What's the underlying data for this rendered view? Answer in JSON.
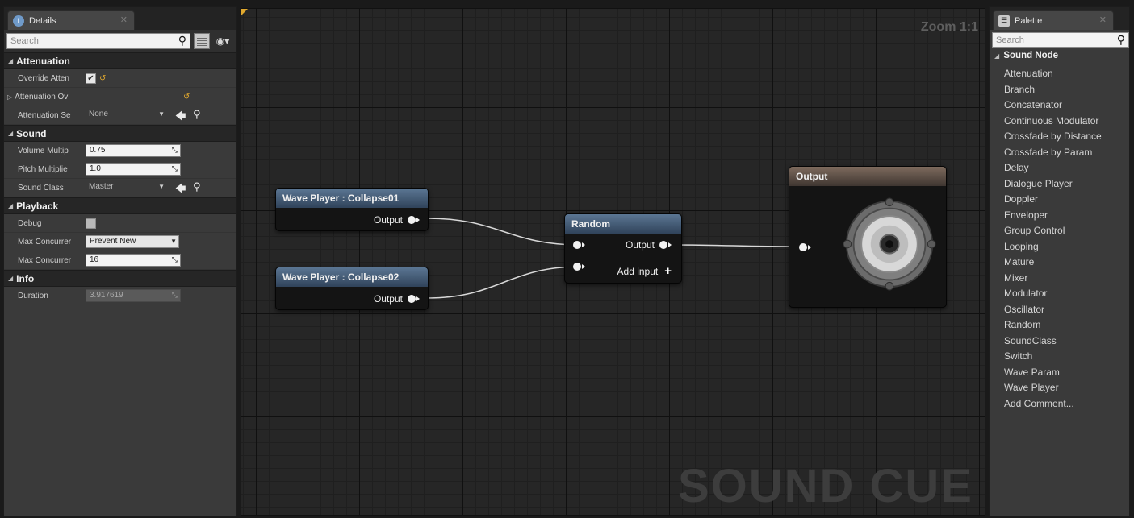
{
  "details": {
    "tab_title": "Details",
    "search_placeholder": "Search",
    "categories": {
      "attenuation": "Attenuation",
      "sound": "Sound",
      "playback": "Playback",
      "info": "Info"
    },
    "props": {
      "override_atten": "Override Atten",
      "attenuation_ov": "Attenuation Ov",
      "attenuation_se": "Attenuation Se",
      "attenuation_se_value": "None",
      "volume_multip": "Volume Multip",
      "volume_value": "0.75",
      "pitch_multiplie": "Pitch Multiplie",
      "pitch_value": "1.0",
      "sound_class": "Sound Class",
      "sound_class_value": "Master",
      "debug": "Debug",
      "max_concurrent_res": "Max Concurrer",
      "max_concurrent_res_value": "Prevent New",
      "max_concurrent_num": "Max Concurrer",
      "max_concurrent_num_value": "16",
      "duration": "Duration",
      "duration_value": "3.917619"
    }
  },
  "graph": {
    "zoom": "Zoom 1:1",
    "watermark": "SOUND CUE",
    "nodes": {
      "wave1_title": "Wave Player : Collapse01",
      "wave2_title": "Wave Player : Collapse02",
      "random_title": "Random",
      "output_title": "Output",
      "output_pin": "Output",
      "add_input": "Add input"
    }
  },
  "palette": {
    "tab_title": "Palette",
    "search_placeholder": "Search",
    "category": "Sound Node",
    "items": [
      "Attenuation",
      "Branch",
      "Concatenator",
      "Continuous Modulator",
      "Crossfade by Distance",
      "Crossfade by Param",
      "Delay",
      "Dialogue Player",
      "Doppler",
      "Enveloper",
      "Group Control",
      "Looping",
      "Mature",
      "Mixer",
      "Modulator",
      "Oscillator",
      "Random",
      "SoundClass",
      "Switch",
      "Wave Param",
      "Wave Player",
      "Add Comment..."
    ]
  }
}
